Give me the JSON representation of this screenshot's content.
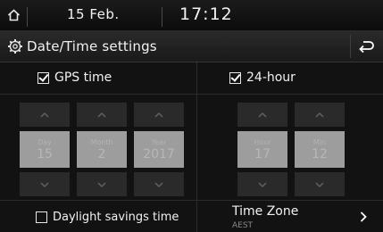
{
  "status": {
    "date": "15 Feb.",
    "time": "17:12"
  },
  "header": {
    "title": "Date/Time settings"
  },
  "options": {
    "gps_time": {
      "label": "GPS time",
      "checked": true
    },
    "hour24": {
      "label": "24-hour",
      "checked": true
    },
    "daylight": {
      "label": "Daylight savings time",
      "checked": false
    }
  },
  "date_spinners": [
    {
      "label": "Day",
      "value": "15"
    },
    {
      "label": "Month",
      "value": "2"
    },
    {
      "label": "Year",
      "value": "2017"
    }
  ],
  "time_spinners": [
    {
      "label": "Hour",
      "value": "17"
    },
    {
      "label": "Min",
      "value": "12"
    }
  ],
  "timezone": {
    "label": "Time Zone",
    "value": "AEST"
  },
  "icons": {
    "home": "home-icon",
    "settings": "gear-icon",
    "back": "back-icon",
    "up": "chevron-up-icon",
    "down": "chevron-down-icon",
    "next": "chevron-right-icon"
  }
}
